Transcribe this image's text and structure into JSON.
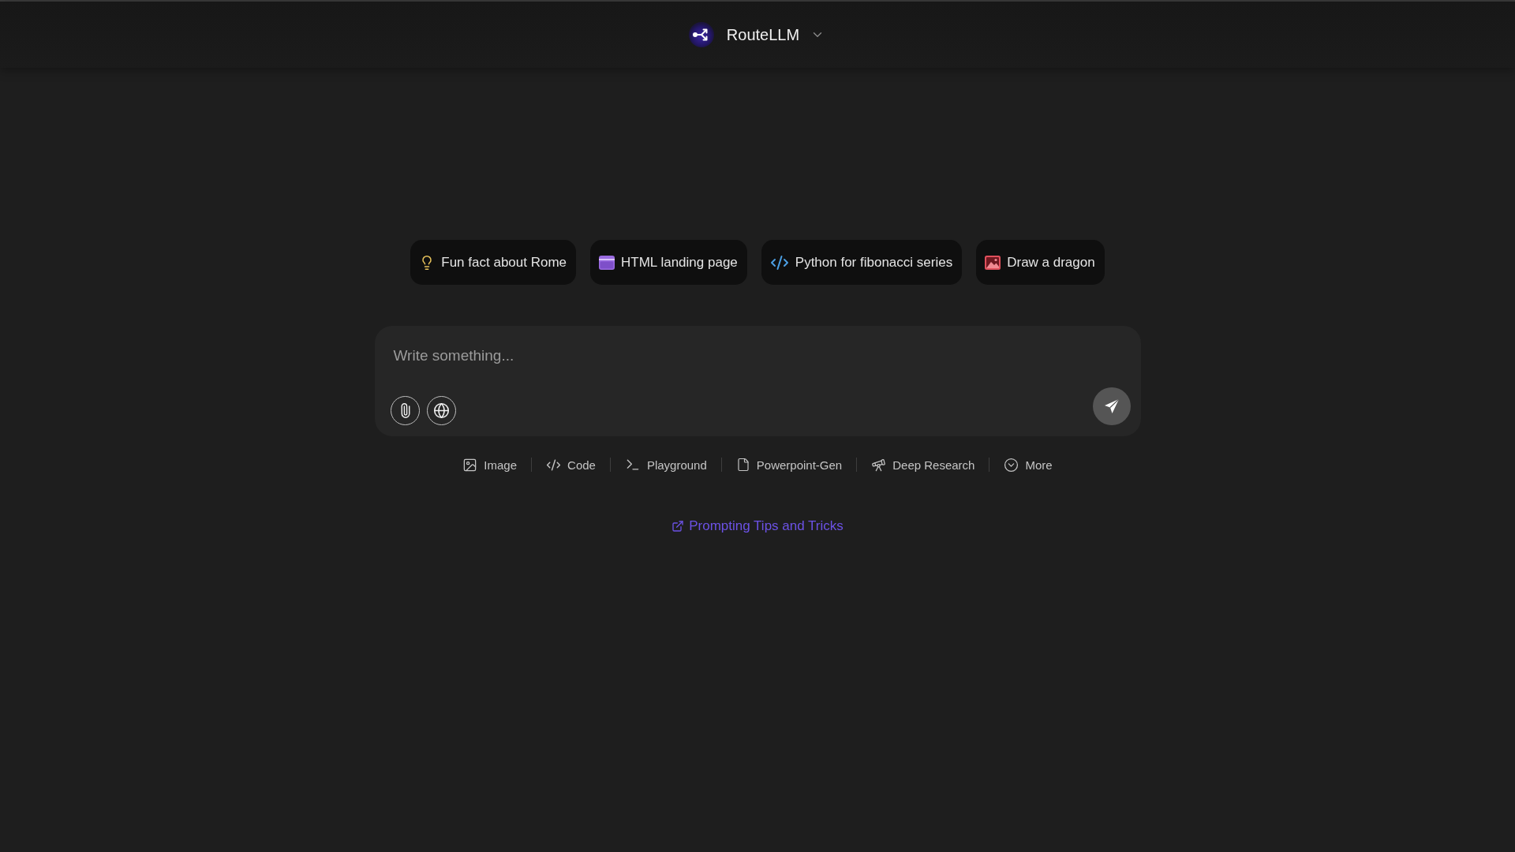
{
  "header": {
    "title": "RouteLLM"
  },
  "suggestions": [
    {
      "label": "Fun fact about Rome",
      "kind": "idea"
    },
    {
      "label": "HTML landing page",
      "kind": "webpage"
    },
    {
      "label": "Python for fibonacci series",
      "kind": "code"
    },
    {
      "label": "Draw a dragon",
      "kind": "image"
    }
  ],
  "composer": {
    "placeholder": "Write something..."
  },
  "modes": [
    {
      "label": "Image",
      "kind": "image"
    },
    {
      "label": "Code",
      "kind": "code"
    },
    {
      "label": "Playground",
      "kind": "playground"
    },
    {
      "label": "Powerpoint-Gen",
      "kind": "slides"
    },
    {
      "label": "Deep Research",
      "kind": "research"
    },
    {
      "label": "More",
      "kind": "more"
    }
  ],
  "link": {
    "label": "Prompting Tips and Tricks"
  }
}
